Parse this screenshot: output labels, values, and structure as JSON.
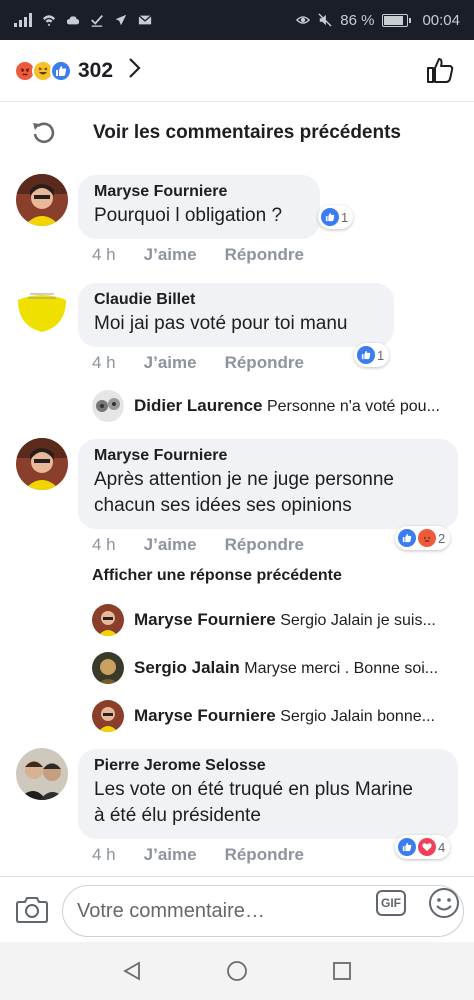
{
  "status_bar": {
    "battery_percent": "86 %",
    "battery_level": 0.86,
    "time": "00:04",
    "icons": [
      "signal-icon",
      "wifi-icon",
      "cloud-icon",
      "check-icon",
      "airplane-icon",
      "mail-icon",
      "eye-icon",
      "mute-icon",
      "battery-icon"
    ]
  },
  "reactions_header": {
    "count": "302",
    "icons": [
      "angry-reaction-icon",
      "haha-reaction-icon",
      "like-reaction-icon"
    ]
  },
  "previous_comments_label": "Voir les commentaires précédents",
  "actions": {
    "like": "J’aime",
    "reply": "Répondre"
  },
  "comments": [
    {
      "author": "Maryse Fourniere",
      "text": [
        "Pourquoi l obligation ?"
      ],
      "time": "4 h",
      "reaction_count": "1",
      "reactions": [
        "like"
      ]
    },
    {
      "author": "Claudie Billet",
      "text": [
        "Moi jai pas voté pour toi manu"
      ],
      "time": "4 h",
      "reaction_count": "1",
      "reactions": [
        "like"
      ],
      "replies": [
        {
          "author": "Didier Laurence",
          "text": "Personne n'a voté pou..."
        }
      ]
    },
    {
      "author": "Maryse Fourniere",
      "text": [
        "Après attention je ne juge personne",
        "chacun ses idées ses opinions"
      ],
      "time": "4 h",
      "reaction_count": "2",
      "reactions": [
        "like",
        "angry"
      ],
      "show_previous_reply": "Afficher une réponse précédente",
      "replies": [
        {
          "author": "Maryse Fourniere",
          "text": "Sergio Jalain je suis..."
        },
        {
          "author": "Sergio Jalain",
          "text": "Maryse merci . Bonne soi..."
        },
        {
          "author": "Maryse Fourniere",
          "text": "Sergio Jalain bonne..."
        }
      ]
    },
    {
      "author": "Pierre Jerome Selosse",
      "text": [
        "Les vote on été truqué en plus Marine",
        "à été élu présidente"
      ],
      "time": "4 h",
      "reaction_count": "4",
      "reactions": [
        "like",
        "love"
      ]
    }
  ],
  "composer": {
    "placeholder": "Votre commentaire…",
    "gif_label": "GIF"
  },
  "colors": {
    "status_bar_bg": "#1a1e29",
    "like_blue": "#3b7cf0",
    "angry_orange": "#f05a3c",
    "love_red": "#f0405c",
    "bubble_bg": "#f0f2f5",
    "muted_text": "#8d949e"
  }
}
